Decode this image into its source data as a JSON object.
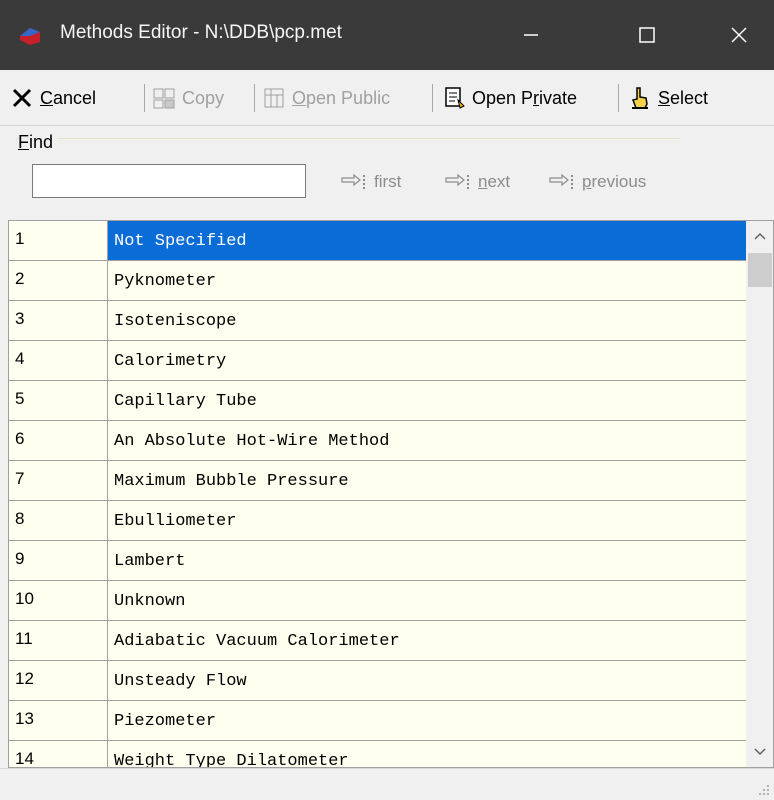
{
  "window": {
    "title": "Methods Editor - N:\\DDB\\pcp.met",
    "minimize_glyph": "—",
    "maximize_glyph": "☐",
    "close_glyph": "✕"
  },
  "toolbar": {
    "cancel": {
      "label_u": "C",
      "label_rest": "ancel",
      "icon": "close-x-icon"
    },
    "copy": {
      "label": "Copy",
      "icon": "copy-icon",
      "disabled": true
    },
    "open_public": {
      "label_u": "O",
      "label_rest": "pen Public",
      "icon": "open-public-icon",
      "disabled": true
    },
    "open_private": {
      "label_pre": "Open P",
      "label_u": "r",
      "label_rest": "ivate",
      "icon": "open-private-icon"
    },
    "select": {
      "label_u": "S",
      "label_rest": "elect",
      "icon": "pointing-hand-icon"
    }
  },
  "find": {
    "label_u": "F",
    "label_rest": "ind",
    "value": "",
    "first_label": "first",
    "next_u": "n",
    "next_rest": "ext",
    "previous_u": "p",
    "previous_rest": "revious"
  },
  "grid": {
    "selected_index": 0,
    "rows": [
      {
        "num": "1",
        "name": "Not Specified"
      },
      {
        "num": "2",
        "name": "Pyknometer"
      },
      {
        "num": "3",
        "name": "Isoteniscope"
      },
      {
        "num": "4",
        "name": "Calorimetry"
      },
      {
        "num": "5",
        "name": "Capillary Tube"
      },
      {
        "num": "6",
        "name": "An Absolute Hot-Wire Method"
      },
      {
        "num": "7",
        "name": "Maximum Bubble Pressure"
      },
      {
        "num": "8",
        "name": "Ebulliometer"
      },
      {
        "num": "9",
        "name": "Lambert"
      },
      {
        "num": "10",
        "name": "Unknown"
      },
      {
        "num": "11",
        "name": "Adiabatic Vacuum Calorimeter"
      },
      {
        "num": "12",
        "name": "Unsteady Flow"
      },
      {
        "num": "13",
        "name": "Piezometer"
      },
      {
        "num": "14",
        "name": "Weight Type Dilatometer"
      }
    ]
  },
  "colors": {
    "titlebar": "#3a3a3a",
    "selection": "#0a6cd6",
    "grid_background": "#fffff0",
    "find_border": "#e6e3c6"
  }
}
